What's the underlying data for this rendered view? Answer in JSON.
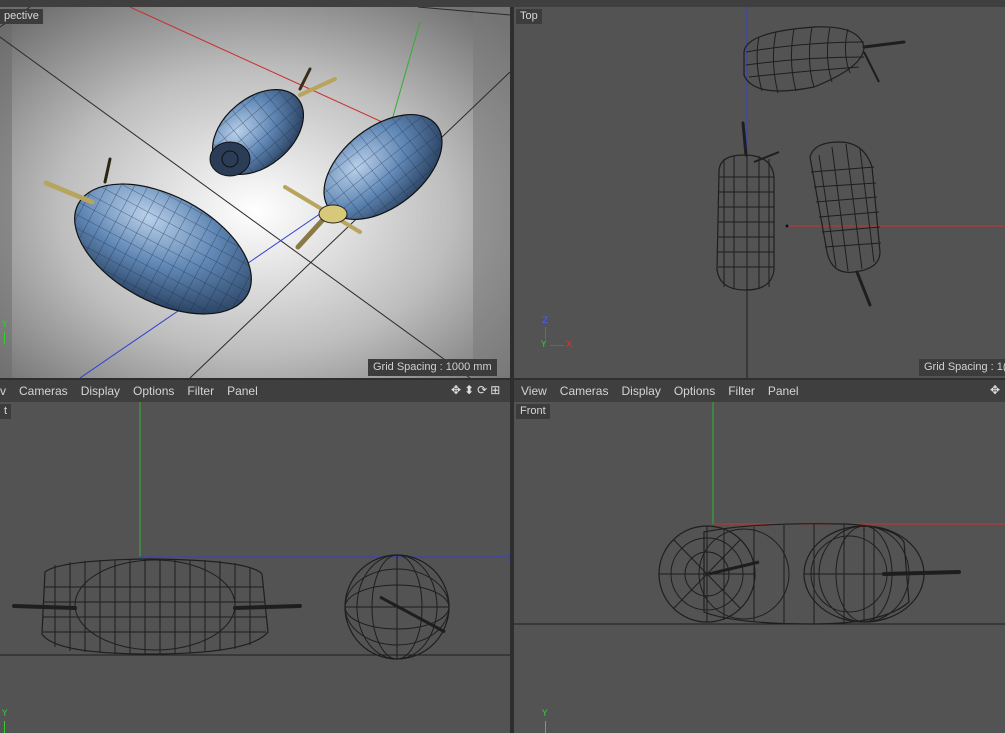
{
  "viewports": {
    "perspective": {
      "label": "pective",
      "grid": "Grid Spacing : 1000 mm"
    },
    "top": {
      "label": "Top",
      "grid": "Grid Spacing : 1("
    },
    "right": {
      "label": "t"
    },
    "front": {
      "label": "Front"
    }
  },
  "menubar_left": {
    "items": [
      "v",
      "Cameras",
      "Display",
      "Options",
      "Filter",
      "Panel"
    ]
  },
  "menubar_right": {
    "items": [
      "View",
      "Cameras",
      "Display",
      "Options",
      "Filter",
      "Panel"
    ]
  },
  "axes": {
    "x": "X",
    "y": "Y",
    "z": "Z"
  },
  "icons": [
    "move-icon",
    "scale-icon",
    "rotate-icon",
    "toggle-view-icon"
  ],
  "colors": {
    "bg": "#4a4a4a",
    "panel": "#3f3f3f",
    "x_axis": "#c83030",
    "y_axis": "#30b030",
    "z_axis": "#3040d0",
    "wire": "#1e1e1e",
    "mesh_blue": "#5b7fa8"
  }
}
